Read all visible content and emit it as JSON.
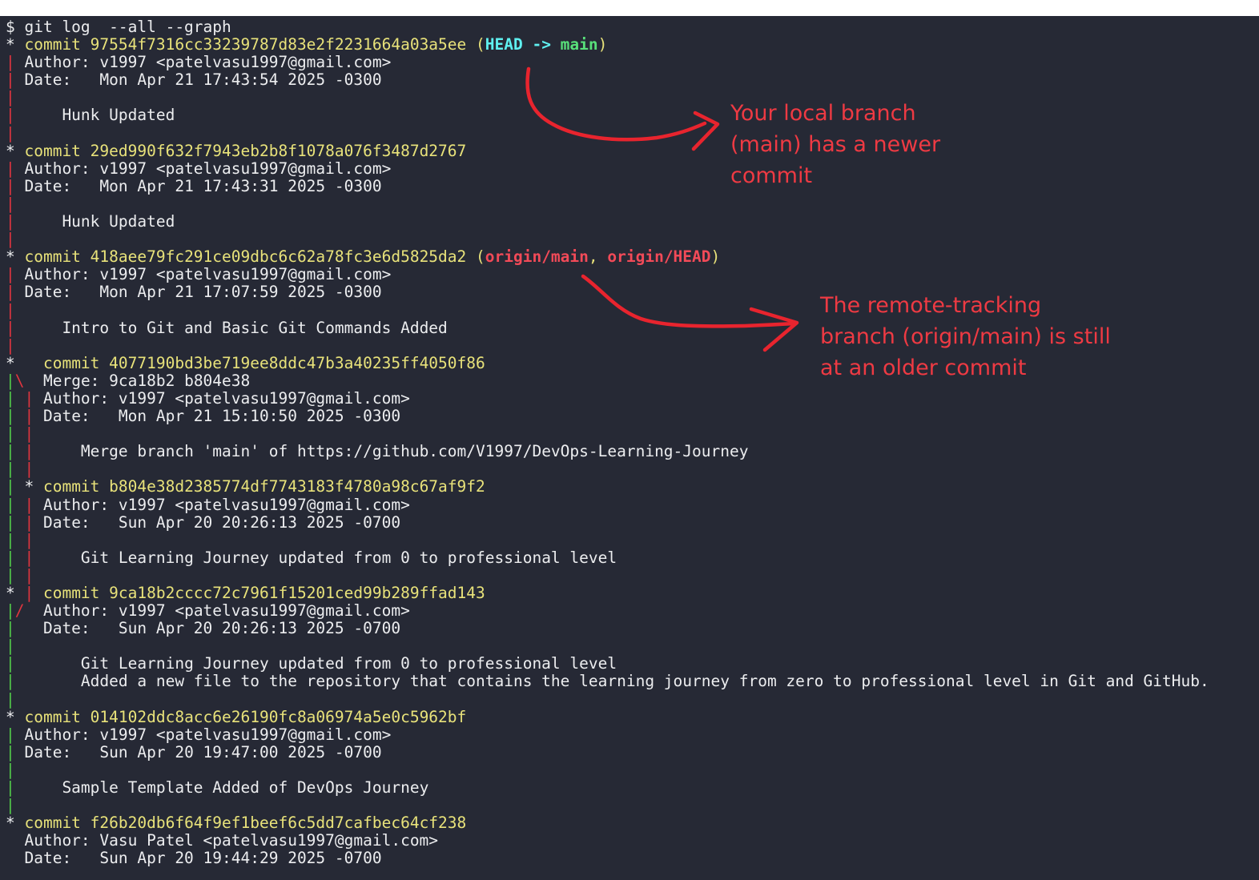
{
  "terminal": {
    "lines": [
      [
        {
          "t": "$ git log  --all --graph",
          "c": "prompt"
        }
      ],
      [
        {
          "t": "* ",
          "c": "text"
        },
        {
          "t": "commit 97554f7316cc33239787d83e2f2231664a03a5ee (",
          "c": "commit"
        },
        {
          "t": "HEAD -> ",
          "c": "head"
        },
        {
          "t": "main",
          "c": "local"
        },
        {
          "t": ")",
          "c": "commit"
        }
      ],
      [
        {
          "t": "| ",
          "c": "red"
        },
        {
          "t": "Author: v1997 <patelvasu1997@gmail.com>",
          "c": "text"
        }
      ],
      [
        {
          "t": "| ",
          "c": "red"
        },
        {
          "t": "Date:   Mon Apr 21 17:43:54 2025 -0300",
          "c": "text"
        }
      ],
      [
        {
          "t": "|",
          "c": "red"
        }
      ],
      [
        {
          "t": "| ",
          "c": "red"
        },
        {
          "t": "    Hunk Updated",
          "c": "text"
        }
      ],
      [
        {
          "t": "|",
          "c": "red"
        }
      ],
      [
        {
          "t": "* ",
          "c": "text"
        },
        {
          "t": "commit 29ed990f632f7943eb2b8f1078a076f3487d2767",
          "c": "commit"
        }
      ],
      [
        {
          "t": "| ",
          "c": "red"
        },
        {
          "t": "Author: v1997 <patelvasu1997@gmail.com>",
          "c": "text"
        }
      ],
      [
        {
          "t": "| ",
          "c": "red"
        },
        {
          "t": "Date:   Mon Apr 21 17:43:31 2025 -0300",
          "c": "text"
        }
      ],
      [
        {
          "t": "|",
          "c": "red"
        }
      ],
      [
        {
          "t": "| ",
          "c": "red"
        },
        {
          "t": "    Hunk Updated",
          "c": "text"
        }
      ],
      [
        {
          "t": "|",
          "c": "red"
        }
      ],
      [
        {
          "t": "* ",
          "c": "text"
        },
        {
          "t": "commit 418aee79fc291ce09dbc6c62a78fc3e6d5825da2 (",
          "c": "commit"
        },
        {
          "t": "origin/main",
          "c": "remote"
        },
        {
          "t": ", ",
          "c": "commit"
        },
        {
          "t": "origin/HEAD",
          "c": "remote"
        },
        {
          "t": ")",
          "c": "commit"
        }
      ],
      [
        {
          "t": "| ",
          "c": "red"
        },
        {
          "t": "Author: v1997 <patelvasu1997@gmail.com>",
          "c": "text"
        }
      ],
      [
        {
          "t": "| ",
          "c": "red"
        },
        {
          "t": "Date:   Mon Apr 21 17:07:59 2025 -0300",
          "c": "text"
        }
      ],
      [
        {
          "t": "|",
          "c": "red"
        }
      ],
      [
        {
          "t": "| ",
          "c": "red"
        },
        {
          "t": "    Intro to Git and Basic Git Commands Added",
          "c": "text"
        }
      ],
      [
        {
          "t": "|",
          "c": "red"
        }
      ],
      [
        {
          "t": "*   ",
          "c": "text"
        },
        {
          "t": "commit 4077190bd3be719ee8ddc47b3a40235ff4050f86",
          "c": "commit"
        }
      ],
      [
        {
          "t": "|",
          "c": "green"
        },
        {
          "t": "\\",
          "c": "red"
        },
        {
          "t": "  Merge: 9ca18b2 b804e38",
          "c": "text"
        }
      ],
      [
        {
          "t": "| ",
          "c": "green"
        },
        {
          "t": "| ",
          "c": "red"
        },
        {
          "t": "Author: v1997 <patelvasu1997@gmail.com>",
          "c": "text"
        }
      ],
      [
        {
          "t": "| ",
          "c": "green"
        },
        {
          "t": "| ",
          "c": "red"
        },
        {
          "t": "Date:   Mon Apr 21 15:10:50 2025 -0300",
          "c": "text"
        }
      ],
      [
        {
          "t": "| ",
          "c": "green"
        },
        {
          "t": "|",
          "c": "red"
        }
      ],
      [
        {
          "t": "| ",
          "c": "green"
        },
        {
          "t": "| ",
          "c": "red"
        },
        {
          "t": "    Merge branch 'main' of https://github.com/V1997/DevOps-Learning-Journey",
          "c": "text"
        }
      ],
      [
        {
          "t": "| ",
          "c": "green"
        },
        {
          "t": "|",
          "c": "red"
        }
      ],
      [
        {
          "t": "| ",
          "c": "green"
        },
        {
          "t": "* ",
          "c": "text"
        },
        {
          "t": "commit b804e38d2385774df7743183f4780a98c67af9f2",
          "c": "commit"
        }
      ],
      [
        {
          "t": "| ",
          "c": "green"
        },
        {
          "t": "| ",
          "c": "red"
        },
        {
          "t": "Author: v1997 <patelvasu1997@gmail.com>",
          "c": "text"
        }
      ],
      [
        {
          "t": "| ",
          "c": "green"
        },
        {
          "t": "| ",
          "c": "red"
        },
        {
          "t": "Date:   Sun Apr 20 20:26:13 2025 -0700",
          "c": "text"
        }
      ],
      [
        {
          "t": "| ",
          "c": "green"
        },
        {
          "t": "|",
          "c": "red"
        }
      ],
      [
        {
          "t": "| ",
          "c": "green"
        },
        {
          "t": "| ",
          "c": "red"
        },
        {
          "t": "    Git Learning Journey updated from 0 to professional level",
          "c": "text"
        }
      ],
      [
        {
          "t": "| ",
          "c": "green"
        },
        {
          "t": "|",
          "c": "red"
        }
      ],
      [
        {
          "t": "* ",
          "c": "text"
        },
        {
          "t": "| ",
          "c": "red"
        },
        {
          "t": "commit 9ca18b2cccc72c7961f15201ced99b289ffad143",
          "c": "commit"
        }
      ],
      [
        {
          "t": "|",
          "c": "green"
        },
        {
          "t": "/ ",
          "c": "red"
        },
        {
          "t": " Author: v1997 <patelvasu1997@gmail.com>",
          "c": "text"
        }
      ],
      [
        {
          "t": "| ",
          "c": "green"
        },
        {
          "t": "  Date:   Sun Apr 20 20:26:13 2025 -0700",
          "c": "text"
        }
      ],
      [
        {
          "t": "|",
          "c": "green"
        }
      ],
      [
        {
          "t": "| ",
          "c": "green"
        },
        {
          "t": "      Git Learning Journey updated from 0 to professional level",
          "c": "text"
        }
      ],
      [
        {
          "t": "| ",
          "c": "green"
        },
        {
          "t": "      Added a new file to the repository that contains the learning journey from zero to professional level in Git and GitHub.",
          "c": "text"
        }
      ],
      [
        {
          "t": "|",
          "c": "green"
        }
      ],
      [
        {
          "t": "* ",
          "c": "text"
        },
        {
          "t": "commit 014102ddc8acc6e26190fc8a06974a5e0c5962bf",
          "c": "commit"
        }
      ],
      [
        {
          "t": "| ",
          "c": "green"
        },
        {
          "t": "Author: v1997 <patelvasu1997@gmail.com>",
          "c": "text"
        }
      ],
      [
        {
          "t": "| ",
          "c": "green"
        },
        {
          "t": "Date:   Sun Apr 20 19:47:00 2025 -0700",
          "c": "text"
        }
      ],
      [
        {
          "t": "|",
          "c": "green"
        }
      ],
      [
        {
          "t": "| ",
          "c": "green"
        },
        {
          "t": "    Sample Template Added of DevOps Journey",
          "c": "text"
        }
      ],
      [
        {
          "t": "|",
          "c": "green"
        }
      ],
      [
        {
          "t": "* ",
          "c": "text"
        },
        {
          "t": "commit f26b20db6f64f9ef1beef6c5dd7cafbec64cf238",
          "c": "commit"
        }
      ],
      [
        {
          "t": "  Author: Vasu Patel <patelvasu1997@gmail.com>",
          "c": "text"
        }
      ],
      [
        {
          "t": "  Date:   Sun Apr 20 19:44:29 2025 -0700",
          "c": "text"
        }
      ]
    ]
  },
  "annotations": {
    "local": {
      "lines": [
        "Your local branch",
        "(main) has a newer",
        "commit"
      ]
    },
    "remote": {
      "lines": [
        "The remote-tracking",
        "branch (origin/main) is still",
        "at an older commit"
      ]
    }
  },
  "colors": {
    "background": "#262935",
    "text": "#ecedef",
    "commit": "#e8e27a",
    "head": "#5ff0f0",
    "local_branch": "#58e07a",
    "remote_branch": "#f24a58",
    "graph_red": "#e0353f",
    "graph_green": "#52c94a",
    "annotation": "#ee3a43"
  }
}
